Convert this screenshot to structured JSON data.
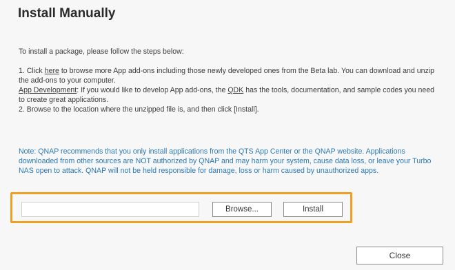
{
  "dialog": {
    "title": "Install Manually",
    "intro": "To install a package, please follow the steps below:",
    "step1": {
      "prefix": "1. Click ",
      "link": "here",
      "suffix": " to browse more App add-ons including those newly developed ones from the Beta lab. You can download and unzip the add-ons to your computer."
    },
    "app_dev": {
      "link": "App Development",
      "middle": ": If you would like to develop App add-ons, the ",
      "qdk_link": "QDK",
      "suffix": " has the tools, documentation, and sample codes you need to create great applications."
    },
    "step2": "2. Browse to the location where the unzipped file is, and then click [Install].",
    "note": "Note: QNAP recommends that you only install applications from the QTS App Center or the QNAP website. Applications downloaded from other sources are NOT authorized by QNAP and may harm your system, cause data loss, or leave your Turbo NAS open to attack. QNAP will not be held responsible for damage, loss or harm caused by unauthorized apps.",
    "file_input": {
      "value": "",
      "placeholder": ""
    },
    "browse_label": "Browse...",
    "install_label": "Install",
    "close_label": "Close",
    "highlight_color": "#f0a020",
    "note_color": "#2a7ab8"
  }
}
